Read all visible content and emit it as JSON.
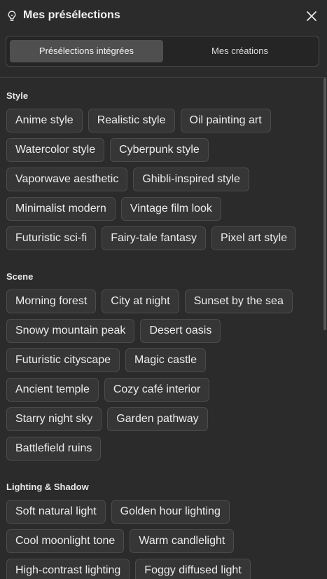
{
  "header": {
    "title": "Mes présélections",
    "icon": "lightbulb-icon",
    "close_icon": "close-icon"
  },
  "tabs": [
    {
      "label": "Présélections intégrées",
      "active": true
    },
    {
      "label": "Mes créations",
      "active": false
    }
  ],
  "sections": {
    "style": {
      "title": "Style",
      "rows": [
        [
          "Anime style",
          "Realistic style",
          "Oil painting art"
        ],
        [
          "Watercolor style",
          "Cyberpunk style"
        ],
        [
          "Vaporwave aesthetic",
          "Ghibli-inspired style"
        ],
        [
          "Minimalist modern",
          "Vintage film look"
        ],
        [
          "Futuristic sci-fi",
          "Fairy-tale fantasy",
          "Pixel art style"
        ]
      ]
    },
    "scene": {
      "title": "Scene",
      "rows": [
        [
          "Morning forest",
          "City at night",
          "Sunset by the sea"
        ],
        [
          "Snowy mountain peak",
          "Desert oasis"
        ],
        [
          "Futuristic cityscape",
          "Magic castle"
        ],
        [
          "Ancient temple",
          "Cozy café interior"
        ],
        [
          "Starry night sky",
          "Garden pathway"
        ],
        [
          "Battlefield ruins"
        ]
      ]
    },
    "lighting": {
      "title": "Lighting & Shadow",
      "rows": [
        [
          "Soft natural light",
          "Golden hour lighting"
        ],
        [
          "Cool moonlight tone",
          "Warm candlelight"
        ],
        [
          "High-contrast lighting",
          "Foggy diffused light"
        ]
      ]
    }
  },
  "colors": {
    "background": "#2b2b2b",
    "chip_bg": "#363636",
    "chip_border": "#4c4c4c",
    "active_tab": "#4f4f4f"
  }
}
